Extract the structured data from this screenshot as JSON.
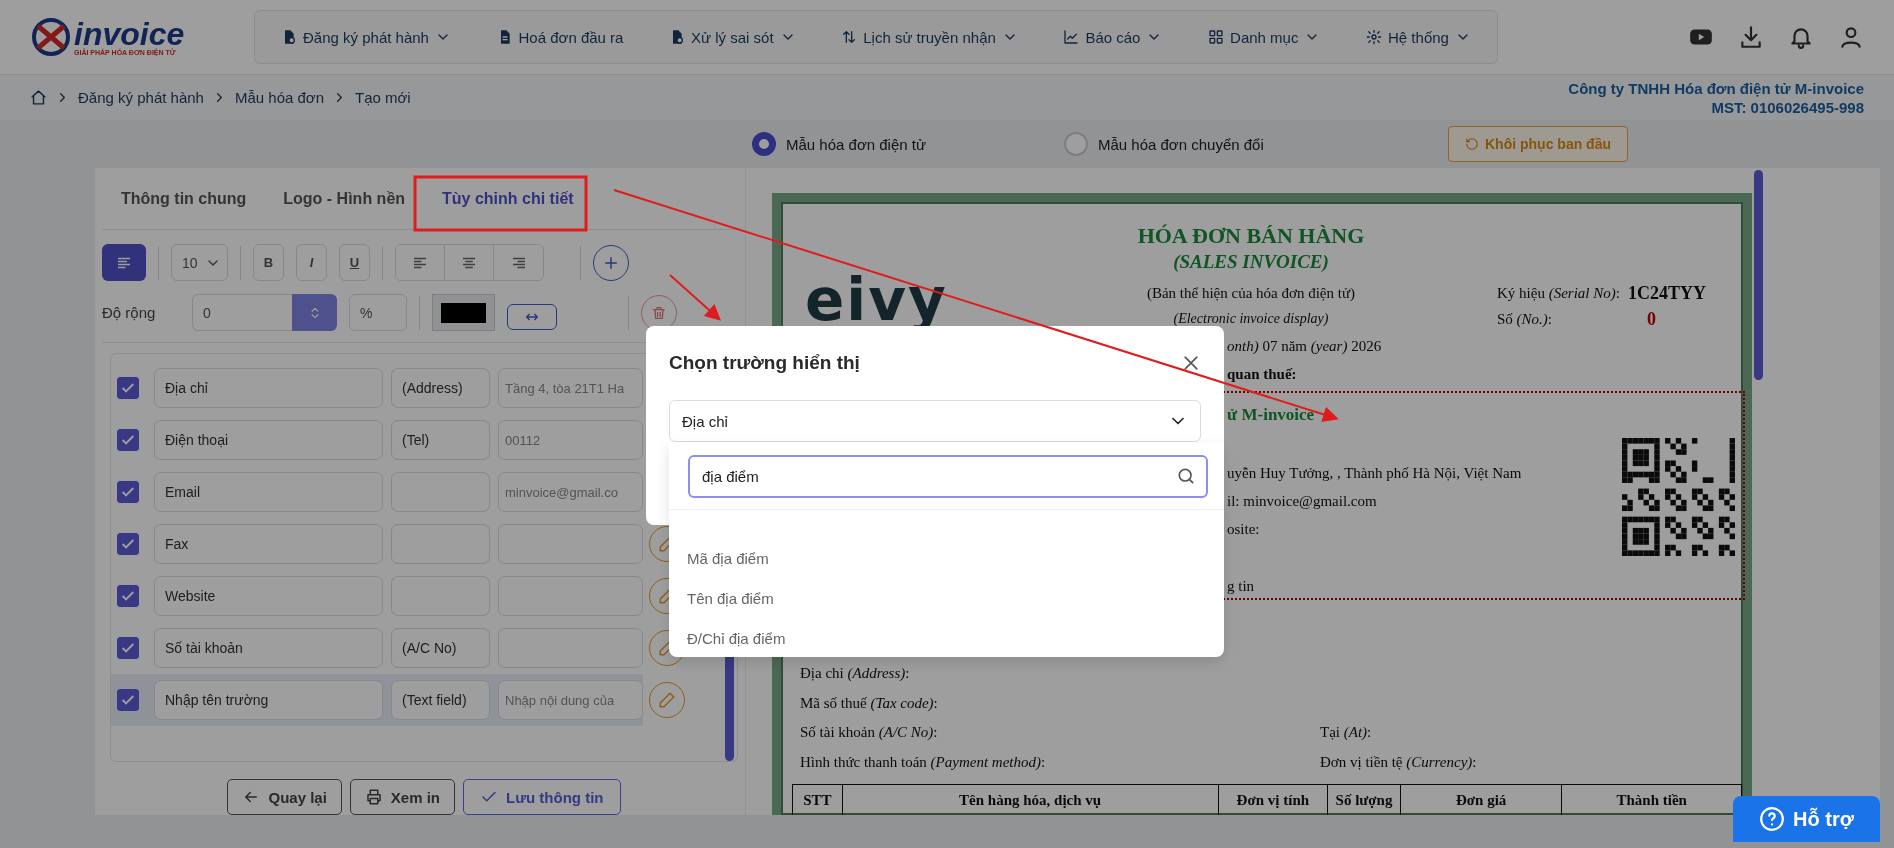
{
  "header": {
    "logo": {
      "name": "invoice",
      "tagline": "GIẢI PHÁP HÓA ĐƠN ĐIỆN TỬ"
    },
    "nav": [
      {
        "label": "Đăng ký phát hành",
        "has_menu": true
      },
      {
        "label": "Hoá đơn đầu ra",
        "has_menu": false
      },
      {
        "label": "Xử lý sai sót",
        "has_menu": true
      },
      {
        "label": "Lịch sử truyền nhận",
        "has_menu": true
      },
      {
        "label": "Báo cáo",
        "has_menu": true
      },
      {
        "label": "Danh mục",
        "has_menu": true
      },
      {
        "label": "Hệ thống",
        "has_menu": true
      }
    ]
  },
  "breadcrumb": [
    "Đăng ký phát hành",
    "Mẫu hóa đơn",
    "Tạo mới"
  ],
  "company": {
    "name": "Công ty TNHH Hóa đơn điện tử M-invoice",
    "tax_id": "MST: 0106026495-998"
  },
  "template_types": [
    {
      "label": "Mẫu hóa đơn điện tử",
      "selected": true
    },
    {
      "label": "Mẫu hóa đơn chuyển đổi",
      "selected": false
    }
  ],
  "restore_button": "Khôi phục ban đầu",
  "editor": {
    "tabs": [
      {
        "label": "Thông tin chung",
        "selected": false
      },
      {
        "label": "Logo - Hình nền",
        "selected": false
      },
      {
        "label": "Tùy chỉnh chi tiết",
        "selected": true
      }
    ],
    "toolbar": {
      "font_size": "10",
      "bold": "B",
      "italic": "I",
      "underline": "U",
      "width_label": "Độ rộng",
      "width_value": "0",
      "unit": "%"
    },
    "fields": [
      {
        "checked": true,
        "name": "Địa chỉ",
        "label": "(Address)",
        "value": "Tầng 4, tòa 21T1 Ha",
        "selected": false,
        "edit_button": false
      },
      {
        "checked": true,
        "name": "Điện thoại",
        "label": "(Tel)",
        "value": "00112",
        "selected": false,
        "edit_button": false
      },
      {
        "checked": true,
        "name": "Email",
        "value": "minvoice@gmail.co",
        "selected": false,
        "edit_button": false
      },
      {
        "checked": true,
        "name": "Fax",
        "selected": false,
        "edit_button": true
      },
      {
        "checked": true,
        "name": "Website",
        "selected": false,
        "edit_button": true
      },
      {
        "checked": true,
        "name": "Số tài khoản",
        "label": "(A/C No)",
        "selected": false,
        "edit_button": true
      },
      {
        "checked": true,
        "name": "Nhập tên trường",
        "label": "(Text field)",
        "placeholder": "Nhập nội dung của",
        "selected": true,
        "edit_button": true
      }
    ],
    "buttons": [
      "Quay lại",
      "Xem in",
      "Lưu thông tin"
    ]
  },
  "invoice": {
    "logo": "eivy",
    "title": "HÓA ĐƠN BÁN HÀNG",
    "subtitle": "(SALES INVOICE)",
    "display_note": "(Bản thể hiện của hóa đơn điện tử)",
    "display_note_en": "(Electronic invoice display)",
    "serial_label": "Ký hiệu *(Serial No)*:",
    "serial": "1C24TYY",
    "number_label": "Số *(No.)*:",
    "number": "0",
    "date": "*onth)* 07 năm *(year)* 2026",
    "tax_authority": "quan thuế:",
    "seller": {
      "name": "ử M-invoice",
      "address": "uyễn Huy Tưởng, , Thành phố Hà Nội, Việt Nam",
      "email": "il: minvoice@gmail.com",
      "website": "osite:",
      "note": "g tin"
    },
    "buyer": [
      {
        "left": "Địa chỉ *(Address)*:"
      },
      {
        "left": "Mã số thuế *(Tax code)*:"
      },
      {
        "left": "Số tài khoản *(A/C No)*:",
        "right": "Tại *(At)*:"
      },
      {
        "left": "Hình thức thanh toán *(Payment method)*:",
        "right": "Đơn vị tiền tệ *(Currency)*:"
      }
    ],
    "table_columns": [
      "STT",
      "Tên hàng hóa, dịch vụ",
      "Đơn vị tính",
      "Số lượng",
      "Đơn giá",
      "Thành tiền"
    ]
  },
  "dialog": {
    "title": "Chọn trường hiển thị",
    "selected_value": "Địa chỉ",
    "search": "địa điểm",
    "options": [
      "Mã địa điểm",
      "Tên địa điểm",
      "Đ/Chỉ địa điểm"
    ]
  },
  "help_button": "Hỗ trợ"
}
